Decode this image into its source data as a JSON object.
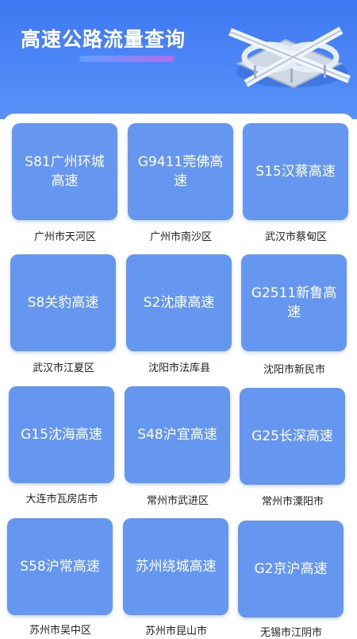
{
  "header": {
    "title": "高速公路流量查询"
  },
  "highways": [
    {
      "name": "S81广州环城高速",
      "location": "广州市天河区"
    },
    {
      "name": "G9411莞佛高速",
      "location": "广州市南沙区"
    },
    {
      "name": "S15汉蔡高速",
      "location": "武汉市蔡甸区"
    },
    {
      "name": "S8关豹高速",
      "location": "武汉市江夏区"
    },
    {
      "name": "S2沈康高速",
      "location": "沈阳市法库县"
    },
    {
      "name": "G2511新鲁高速",
      "location": "沈阳市新民市"
    },
    {
      "name": "G15沈海高速",
      "location": "大连市瓦房店市"
    },
    {
      "name": "S48沪宜高速",
      "location": "常州市武进区"
    },
    {
      "name": "G25长深高速",
      "location": "常州市溧阳市"
    },
    {
      "name": "S58沪常高速",
      "location": "苏州市吴中区"
    },
    {
      "name": "苏州绕城高速",
      "location": "苏州市昆山市"
    },
    {
      "name": "G2京沪高速",
      "location": "无锡市江阴市"
    }
  ],
  "colors": {
    "header_bg": "#4c86f6",
    "card_bg": "#6597f0",
    "accent_line": "#b06cf0"
  }
}
